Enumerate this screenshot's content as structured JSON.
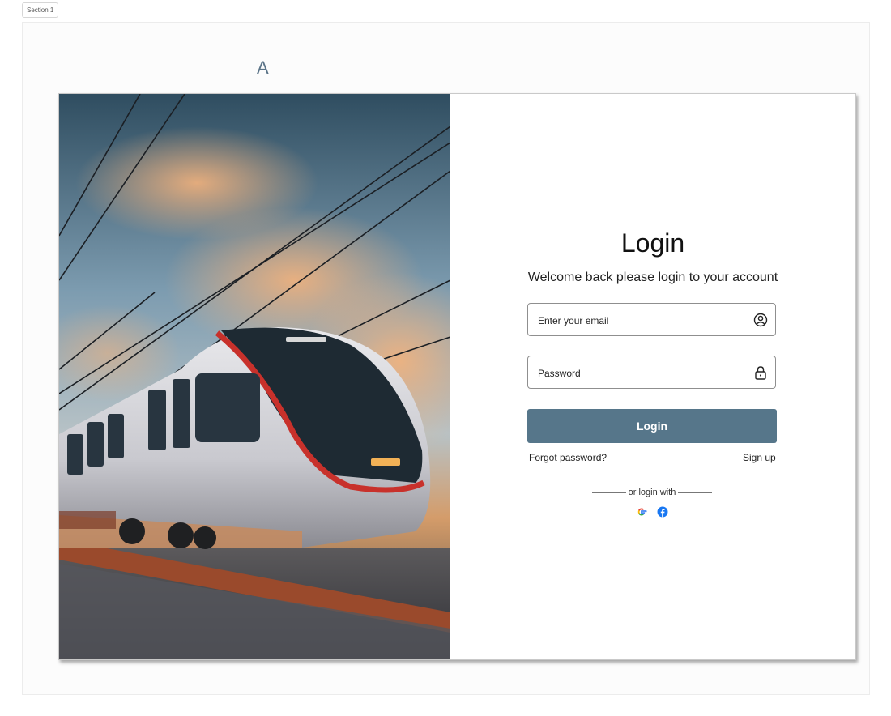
{
  "canvas": {
    "section_label": "Section 1",
    "variant_letter": "A"
  },
  "hero": {
    "image_icon": "high-speed-train-photo"
  },
  "login": {
    "title": "Login",
    "subtitle": "Welcome back please login to your account",
    "email": {
      "placeholder": "Enter your email",
      "value": "",
      "icon": "user-circle-icon"
    },
    "password": {
      "placeholder": "Password",
      "value": "",
      "icon": "lock-icon"
    },
    "submit_label": "Login",
    "forgot_label": "Forgot password?",
    "signup_label": "Sign up",
    "divider_text": "or login with",
    "social": [
      {
        "name": "google",
        "icon": "google-icon"
      },
      {
        "name": "facebook",
        "icon": "facebook-icon"
      }
    ]
  },
  "colors": {
    "accent": "#56768a",
    "field_border": "#8f8f8f",
    "facebook": "#1877f2"
  }
}
